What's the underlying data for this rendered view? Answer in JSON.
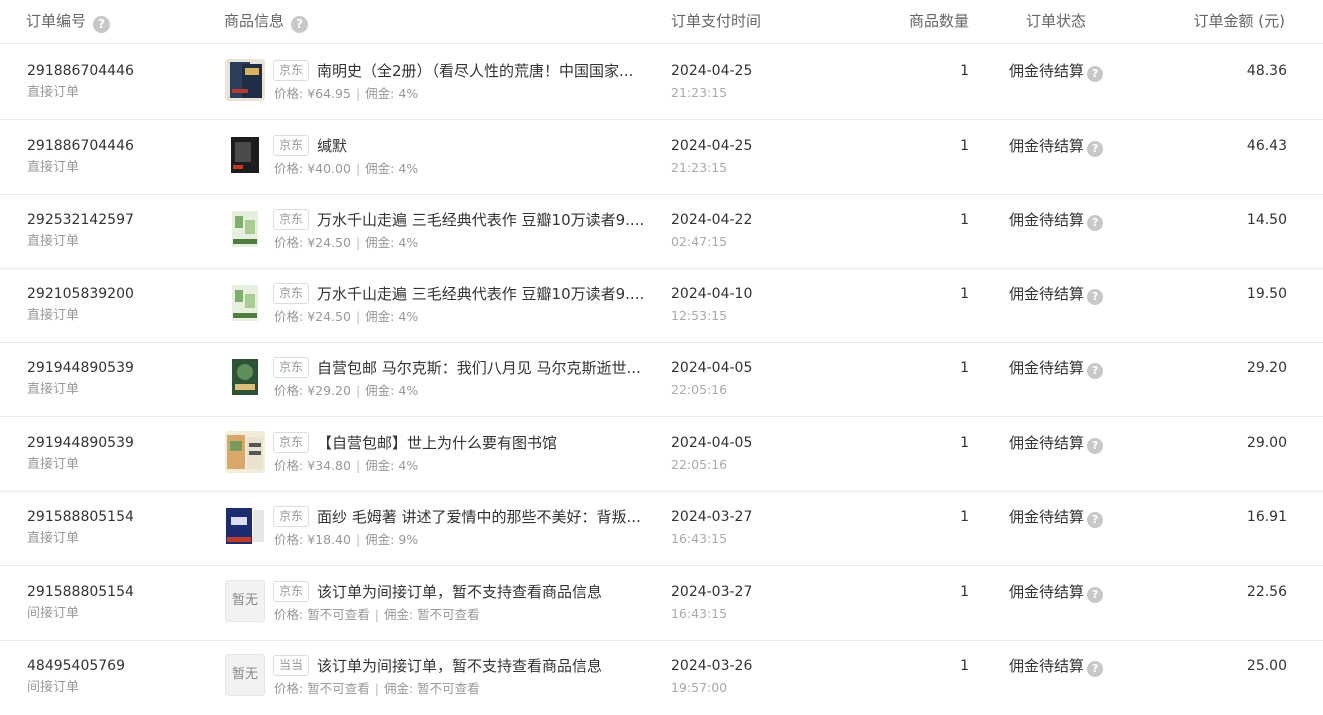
{
  "header": {
    "order_no": "订单编号",
    "goods_info": "商品信息",
    "pay_time": "订单支付时间",
    "quantity": "商品数量",
    "status": "订单状态",
    "amount": "订单金额 (元)"
  },
  "labels": {
    "price_prefix": "价格:",
    "commission_prefix": "佣金:",
    "placeholder_thumb": "暂无"
  },
  "colors": {
    "book_1": "#2b3e5c",
    "book_2": "#1d1d1d",
    "book_3": "#cfe3c4",
    "book_4": "#cfe3c4",
    "book_5": "#2f5236",
    "book_6": "#d9a96a",
    "book_7": "#1c2c6e"
  },
  "orders": [
    {
      "order_id": "291886704446",
      "order_type": "直接订单",
      "platform": "京东",
      "title": "南明史（全2册）（看尽人性的荒唐！中国国家...",
      "price": "¥64.95",
      "commission": "4%",
      "pay_date": "2024-04-25",
      "pay_time": "21:23:15",
      "quantity": "1",
      "status": "佣金待结算",
      "amount": "48.36"
    },
    {
      "order_id": "291886704446",
      "order_type": "直接订单",
      "platform": "京东",
      "title": "缄默",
      "price": "¥40.00",
      "commission": "4%",
      "pay_date": "2024-04-25",
      "pay_time": "21:23:15",
      "quantity": "1",
      "status": "佣金待结算",
      "amount": "46.43"
    },
    {
      "order_id": "292532142597",
      "order_type": "直接订单",
      "platform": "京东",
      "title": "万水千山走遍 三毛经典代表作 豆瓣10万读者9....",
      "price": "¥24.50",
      "commission": "4%",
      "pay_date": "2024-04-22",
      "pay_time": "02:47:15",
      "quantity": "1",
      "status": "佣金待结算",
      "amount": "14.50"
    },
    {
      "order_id": "292105839200",
      "order_type": "直接订单",
      "platform": "京东",
      "title": "万水千山走遍 三毛经典代表作 豆瓣10万读者9....",
      "price": "¥24.50",
      "commission": "4%",
      "pay_date": "2024-04-10",
      "pay_time": "12:53:15",
      "quantity": "1",
      "status": "佣金待结算",
      "amount": "19.50"
    },
    {
      "order_id": "291944890539",
      "order_type": "直接订单",
      "platform": "京东",
      "title": "自营包邮 马尔克斯：我们八月见 马尔克斯逝世...",
      "price": "¥29.20",
      "commission": "4%",
      "pay_date": "2024-04-05",
      "pay_time": "22:05:16",
      "quantity": "1",
      "status": "佣金待结算",
      "amount": "29.20"
    },
    {
      "order_id": "291944890539",
      "order_type": "直接订单",
      "platform": "京东",
      "title": "【自营包邮】世上为什么要有图书馆",
      "price": "¥34.80",
      "commission": "4%",
      "pay_date": "2024-04-05",
      "pay_time": "22:05:16",
      "quantity": "1",
      "status": "佣金待结算",
      "amount": "29.00"
    },
    {
      "order_id": "291588805154",
      "order_type": "直接订单",
      "platform": "京东",
      "title": "面纱 毛姆著 讲述了爱情中的那些不美好：背叛...",
      "price": "¥18.40",
      "commission": "9%",
      "pay_date": "2024-03-27",
      "pay_time": "16:43:15",
      "quantity": "1",
      "status": "佣金待结算",
      "amount": "16.91"
    },
    {
      "order_id": "291588805154",
      "order_type": "间接订单",
      "platform": "京东",
      "title": "该订单为间接订单，暂不支持查看商品信息",
      "price": "暂不可查看",
      "commission": "暂不可查看",
      "pay_date": "2024-03-27",
      "pay_time": "16:43:15",
      "quantity": "1",
      "status": "佣金待结算",
      "amount": "22.56"
    },
    {
      "order_id": "48495405769",
      "order_type": "间接订单",
      "platform": "当当",
      "title": "该订单为间接订单，暂不支持查看商品信息",
      "price": "暂不可查看",
      "commission": "暂不可查看",
      "pay_date": "2024-03-26",
      "pay_time": "19:57:00",
      "quantity": "1",
      "status": "佣金待结算",
      "amount": "25.00"
    }
  ]
}
